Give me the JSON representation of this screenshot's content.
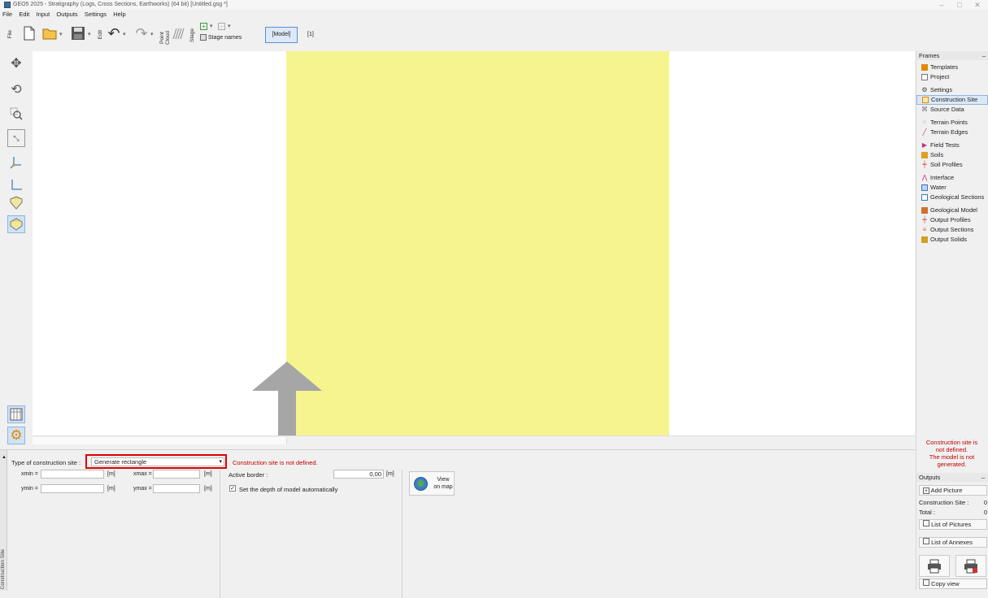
{
  "window": {
    "title": "GEO5 2025 - Stratigraphy (Logs, Cross Sections, Earthworks) (64 bit) [Untitled.gsg *]",
    "controls": [
      "–",
      "□",
      "✕"
    ]
  },
  "menu": [
    "File",
    "Edit",
    "Input",
    "Outputs",
    "Settings",
    "Help"
  ],
  "toolbar": {
    "section_file": "File",
    "section_edit": "Edit",
    "point_cloud": "Point Cloud",
    "stage": "Stage",
    "stage_names": "Stage names",
    "model_button": "[Model]",
    "model_index": "[1]"
  },
  "frames": {
    "header": "Frames",
    "items": [
      {
        "label": "Templates",
        "icon": "templates-icon",
        "color": "#e08a00"
      },
      {
        "label": "Project",
        "icon": "project-icon",
        "color": "#777777"
      },
      {
        "label": "Settings",
        "icon": "settings-icon",
        "color": "#555555"
      },
      {
        "label": "Construction Site",
        "icon": "construction-site-icon",
        "color": "#e08a00"
      },
      {
        "label": "Source Data",
        "icon": "source-data-icon",
        "color": "#777777"
      },
      {
        "label": "Terrain Points",
        "icon": "terrain-points-icon",
        "color": "#999999"
      },
      {
        "label": "Terrain Edges",
        "icon": "terrain-edges-icon",
        "color": "#d0307a"
      },
      {
        "label": "Field Tests",
        "icon": "field-tests-icon",
        "color": "#c0307a"
      },
      {
        "label": "Soils",
        "icon": "soils-icon",
        "color": "#e0a020"
      },
      {
        "label": "Soil Profiles",
        "icon": "soil-profiles-icon",
        "color": "#d05050"
      },
      {
        "label": "Interface",
        "icon": "interface-icon",
        "color": "#d02070"
      },
      {
        "label": "Water",
        "icon": "water-icon",
        "color": "#3a78c8"
      },
      {
        "label": "Geological Sections",
        "icon": "geological-sections-icon",
        "color": "#3a78c8"
      },
      {
        "label": "Geological Model",
        "icon": "geological-model-icon",
        "color": "#d07030"
      },
      {
        "label": "Output Profiles",
        "icon": "output-profiles-icon",
        "color": "#d05050"
      },
      {
        "label": "Output Sections",
        "icon": "output-sections-icon",
        "color": "#d07030"
      },
      {
        "label": "Output Solids",
        "icon": "output-solids-icon",
        "color": "#d0a020"
      }
    ],
    "active_index": 3
  },
  "warning": {
    "line1": "Construction site is",
    "line2": "not defined.",
    "line3": "The model is not",
    "line4": "generated."
  },
  "outputs": {
    "header": "Outputs",
    "add_picture": "Add Picture",
    "construction_site_label": "Construction Site :",
    "construction_site_value": "0",
    "total_label": "Total :",
    "total_value": "0",
    "list_of_pictures": "List of Pictures",
    "list_of_annexes": "List of Annexes",
    "copy_view": "Copy view"
  },
  "bottom": {
    "tab_label": "Construction Site",
    "type_label": "Type of construction site :",
    "type_value": "Generate rectangle",
    "status": "Construction site is not defined.",
    "xmin_label": "xmin =",
    "xmax_label": "xmax =",
    "ymin_label": "ymin =",
    "ymax_label": "ymax =",
    "unit_m": "[m]",
    "active_border_label": "Active border :",
    "active_border_value": "0,00",
    "auto_depth_label": "Set the depth of model automatically",
    "auto_depth_checked": true,
    "view_on_map_1": "View",
    "view_on_map_2": "on map"
  },
  "colors": {
    "canvas_area": "#f6f48f",
    "arrow": "#a6a6a6",
    "warning": "#c00000",
    "highlight_box": "#e00000"
  }
}
